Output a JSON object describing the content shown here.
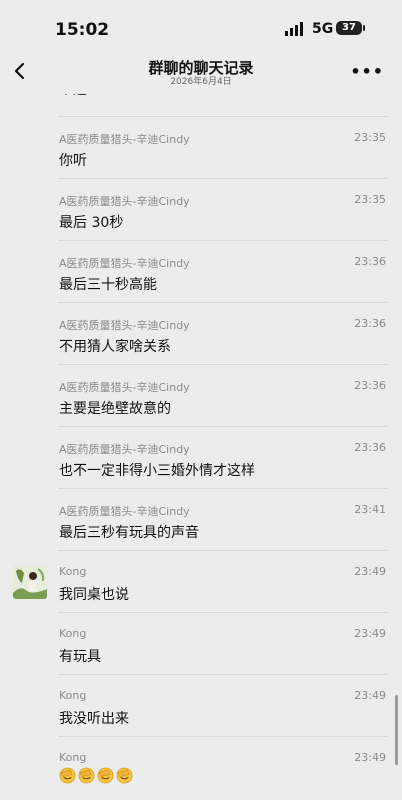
{
  "status_bar": {
    "time": "15:02",
    "network": "5G",
    "battery": "37"
  },
  "nav": {
    "title": "群聊的聊天记录",
    "subtitle": "2026年6月4日"
  },
  "messages": [
    {
      "sender": "",
      "time": "",
      "text": "个适"
    },
    {
      "sender": "A医药质量猎头-辛迪Cindy",
      "time": "23:35",
      "text": "你听"
    },
    {
      "sender": "A医药质量猎头-辛迪Cindy",
      "time": "23:35",
      "text": "最后 30秒"
    },
    {
      "sender": "A医药质量猎头-辛迪Cindy",
      "time": "23:36",
      "text": "最后三十秒高能"
    },
    {
      "sender": "A医药质量猎头-辛迪Cindy",
      "time": "23:36",
      "text": "不用猜人家啥关系"
    },
    {
      "sender": "A医药质量猎头-辛迪Cindy",
      "time": "23:36",
      "text": "主要是绝壁故意的"
    },
    {
      "sender": "A医药质量猎头-辛迪Cindy",
      "time": "23:36",
      "text": "也不一定非得小三婚外情才这样"
    },
    {
      "sender": "A医药质量猎头-辛迪Cindy",
      "time": "23:41",
      "text": "最后三秒有玩具的声音"
    },
    {
      "sender": "Kong",
      "time": "23:49",
      "text": "我同桌也说"
    },
    {
      "sender": "Kong",
      "time": "23:49",
      "text": "有玩具"
    },
    {
      "sender": "Kong",
      "time": "23:49",
      "text": "我没听出来"
    },
    {
      "sender": "Kong",
      "time": "23:49",
      "emoji": [
        "face-palm-icon",
        "face-palm-icon",
        "face-palm-icon",
        "face-palm-icon"
      ]
    }
  ]
}
